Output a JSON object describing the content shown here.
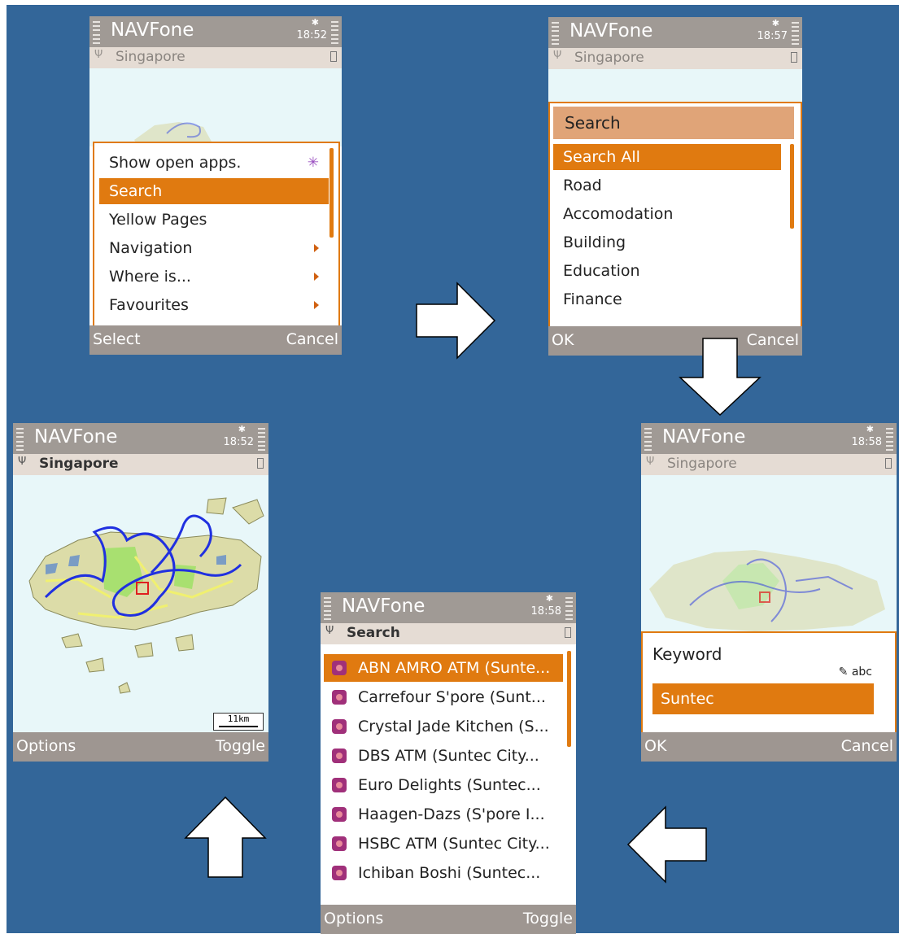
{
  "app_title": "NAVFone",
  "panels": {
    "menu": {
      "time": "18:52",
      "location": "Singapore",
      "items": [
        {
          "label": "Show open apps.",
          "suffix": "task-switch-icon"
        },
        {
          "label": "Search",
          "selected": true
        },
        {
          "label": "Yellow Pages"
        },
        {
          "label": "Navigation",
          "suffix": "submenu-arrow-icon"
        },
        {
          "label": "Where is...",
          "suffix": "submenu-arrow-icon"
        },
        {
          "label": "Favourites",
          "suffix": "submenu-arrow-icon"
        }
      ],
      "left_soft": "Select",
      "right_soft": "Cancel"
    },
    "category": {
      "time": "18:57",
      "location": "Singapore",
      "header": "Search",
      "items": [
        "Search All",
        "Road",
        "Accomodation",
        "Building",
        "Education",
        "Finance"
      ],
      "left_soft": "OK",
      "right_soft": "Cancel"
    },
    "keyword": {
      "time": "18:58",
      "location": "Singapore",
      "label": "Keyword",
      "mode": "abc",
      "value": "Suntec",
      "left_soft": "OK",
      "right_soft": "Cancel"
    },
    "results": {
      "time": "18:58",
      "location": "Search",
      "items": [
        "ABN AMRO ATM (Sunte...",
        "Carrefour S'pore (Sunt...",
        "Crystal Jade Kitchen (S...",
        "DBS ATM (Suntec City...",
        "Euro Delights (Suntec...",
        "Haagen-Dazs (S'pore I...",
        "HSBC ATM (Suntec City...",
        "Ichiban Boshi (Suntec..."
      ],
      "left_soft": "Options",
      "right_soft": "Toggle"
    },
    "map": {
      "time": "18:52",
      "location": "Singapore",
      "scale": "11km",
      "left_soft": "Options",
      "right_soft": "Toggle"
    }
  },
  "colors": {
    "background": "#336699",
    "accent": "#e07a10",
    "titlebar": "#a09a95"
  }
}
